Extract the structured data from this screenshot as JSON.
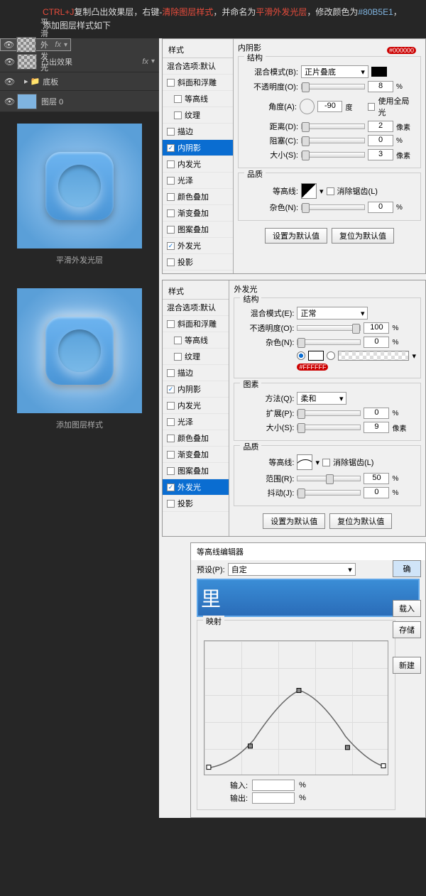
{
  "header": {
    "t1": "CTRL+J",
    "t2": "复制凸出效果层，右键-",
    "t3": "清除图层样式",
    "t4": "，并命名为",
    "t5": "平滑外发光层",
    "t6": "，修改颜色为",
    "color": "#80B5E1",
    "t7": "，添加图层样式如下"
  },
  "layers": [
    {
      "name": "平滑外发光",
      "fx": "fx",
      "selected": true
    },
    {
      "name": "凸出效果",
      "fx": "fx",
      "selected": false
    }
  ],
  "folder": "底板",
  "layer0": "图层 0",
  "preview1": "平滑外发光层",
  "preview2": "添加图层样式",
  "styles_hdr": "样式",
  "blend_opts": "混合选项:默认",
  "style_items": [
    "斜面和浮雕",
    "等高线",
    "纹理",
    "描边",
    "内阴影",
    "内发光",
    "光泽",
    "颜色叠加",
    "渐变叠加",
    "图案叠加",
    "外发光",
    "投影"
  ],
  "panel1": {
    "title": "内阴影",
    "struct": "结构",
    "badge": "#000000",
    "blend_mode_lbl": "混合模式(B):",
    "blend_mode_val": "正片叠底",
    "opacity_lbl": "不透明度(O):",
    "opacity_val": "8",
    "angle_lbl": "角度(A):",
    "angle_val": "-90",
    "angle_unit": "度",
    "global": "使用全局光",
    "dist_lbl": "距离(D):",
    "dist_val": "2",
    "dist_unit": "像素",
    "choke_lbl": "阻塞(C):",
    "choke_val": "0",
    "choke_unit": "%",
    "size_lbl": "大小(S):",
    "size_val": "3",
    "size_unit": "像素",
    "quality": "品质",
    "contour_lbl": "等高线:",
    "antialias": "消除锯齿(L)",
    "noise_lbl": "杂色(N):",
    "noise_val": "0",
    "btn_default": "设置为默认值",
    "btn_reset": "复位为默认值"
  },
  "panel2": {
    "title": "外发光",
    "struct": "结构",
    "blend_mode_lbl": "混合模式(E):",
    "blend_mode_val": "正常",
    "opacity_lbl": "不透明度(O):",
    "opacity_val": "100",
    "noise_lbl": "杂色(N):",
    "noise_val": "0",
    "badge_color": "#FFFFFF",
    "element": "图素",
    "method_lbl": "方法(Q):",
    "method_val": "柔和",
    "spread_lbl": "扩展(P):",
    "spread_val": "0",
    "size_lbl": "大小(S):",
    "size_val": "9",
    "size_unit": "像素",
    "quality": "品质",
    "contour_lbl": "等高线:",
    "antialias": "消除锯齿(L)",
    "range_lbl": "范围(R):",
    "range_val": "50",
    "jitter_lbl": "抖动(J):",
    "jitter_val": "0",
    "btn_default": "设置为默认值",
    "btn_reset": "复位为默认值"
  },
  "contour": {
    "title": "等高线编辑器",
    "preset_lbl": "预设(P):",
    "preset_val": "自定",
    "mapping": "映射",
    "input_lbl": "输入:",
    "output_lbl": "输出:",
    "pct": "%",
    "b_ok": "确",
    "b_load": "载入",
    "b_save": "存储",
    "b_new": "新建"
  },
  "banner": "里",
  "checked_p1": [
    "内阴影",
    "外发光"
  ],
  "checked_p2": [
    "内阴影",
    "外发光"
  ]
}
